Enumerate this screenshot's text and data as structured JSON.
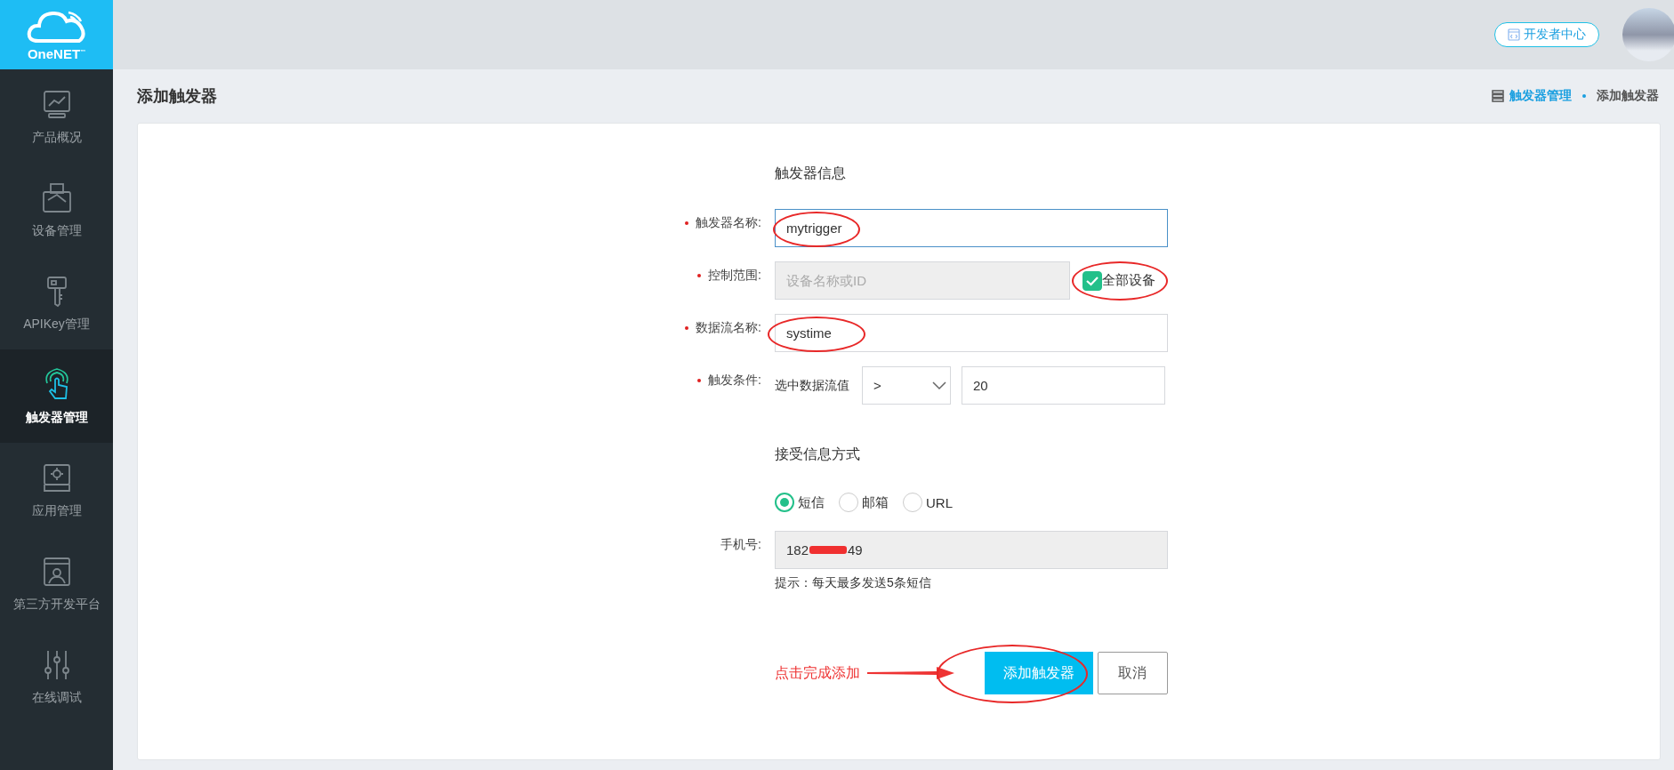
{
  "logo": {
    "text": "OneNET",
    "mark": "™"
  },
  "sidebar": {
    "items": [
      {
        "label": "产品概况",
        "kind": "chart",
        "selected": false
      },
      {
        "label": "设备管理",
        "kind": "printer",
        "selected": false
      },
      {
        "label": "APIKey管理",
        "kind": "key",
        "selected": false
      },
      {
        "label": "触发器管理",
        "kind": "touch",
        "selected": true
      },
      {
        "label": "应用管理",
        "kind": "gear",
        "selected": false
      },
      {
        "label": "第三方开发平台",
        "kind": "profile",
        "selected": false
      },
      {
        "label": "在线调试",
        "kind": "sliders",
        "selected": false
      }
    ]
  },
  "header": {
    "developer_button": "开发者中心"
  },
  "page_title": "添加触发器",
  "breadcrumb": [
    {
      "label": "触发器管理",
      "kind": "link"
    },
    {
      "label": "添加触发器",
      "kind": "current"
    }
  ],
  "form": {
    "section_title": "触发器信息",
    "name": {
      "label": "触发器名称:",
      "required": true,
      "value": "mytrigger",
      "circled": true
    },
    "scope": {
      "label": "控制范围:",
      "required": true,
      "placeholder": "设备名称或ID",
      "all_devices": {
        "label": "全部设备",
        "checked": true,
        "circled": true
      }
    },
    "datastream": {
      "label": "数据流名称:",
      "required": true,
      "value": "systime",
      "circled": true
    },
    "condition": {
      "label": "触发条件:",
      "required": true,
      "prefix": "选中数据流值",
      "operator": ">",
      "value": "20"
    },
    "notify_title": "接受信息方式",
    "methods": [
      {
        "label": "短信",
        "selected": true
      },
      {
        "label": "邮箱",
        "selected": false
      },
      {
        "label": "URL",
        "selected": false
      }
    ],
    "phone": {
      "label": "手机号:",
      "value_start": "182",
      "value_end": "49",
      "redacted": true
    },
    "hint": "提示：每天最多发送5条短信",
    "annotation": "点击完成添加",
    "submit": {
      "label": "添加触发器",
      "circled": true
    },
    "cancel": "取消"
  }
}
